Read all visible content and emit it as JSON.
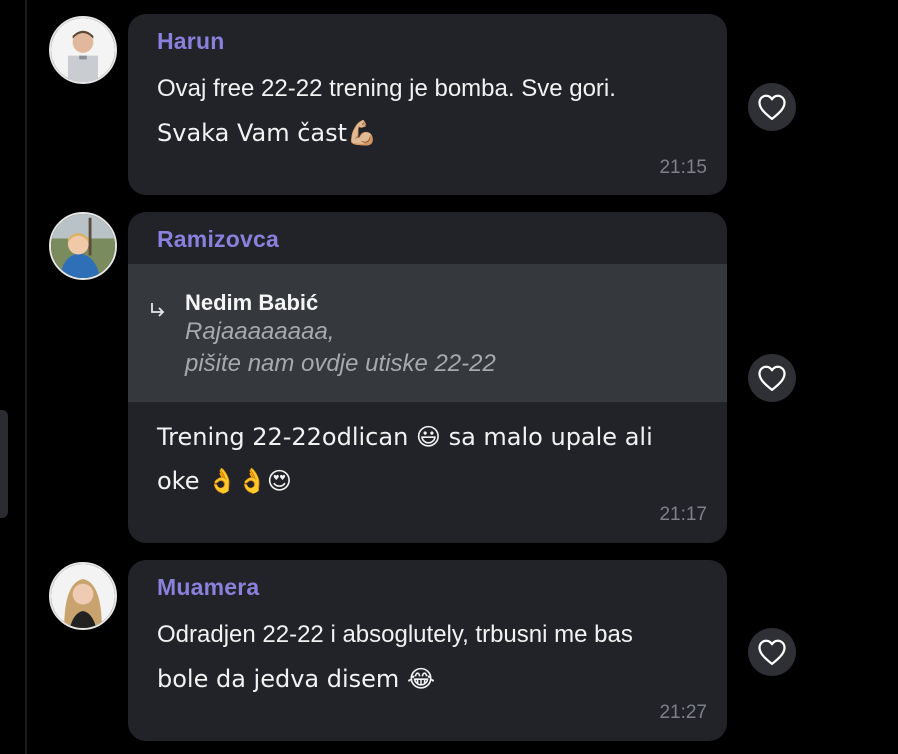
{
  "messages": [
    {
      "author": "Harun",
      "text_line1": "Ovaj free 22-22 trening je bomba. Sve gori.",
      "text_line2": "Svaka Vam čast💪🏼",
      "time": "21:15"
    },
    {
      "author": "Ramizovca",
      "reply": {
        "author": "Nedim Babić",
        "line1": "Rajaaaaaaaa,",
        "line2": "pišite nam ovdje utiske 22-22"
      },
      "text_line1": "Trening 22-22odlican 😃 sa malo upale ali",
      "text_line2": "oke 👌👌😍",
      "time": "21:17"
    },
    {
      "author": "Muamera",
      "text_line1": "Odradjen 22-22 i absoglutely, trbusni me bas",
      "text_line2": "bole da jedva disem 😂",
      "time": "21:27"
    }
  ],
  "colors": {
    "background": "#000000",
    "bubble": "#212328",
    "reply_box": "#35383d",
    "author": "#8b80dc",
    "timestamp": "#7e8187"
  },
  "icons": {
    "like": "heart-outline-icon",
    "reply": "reply-arrow-icon"
  }
}
